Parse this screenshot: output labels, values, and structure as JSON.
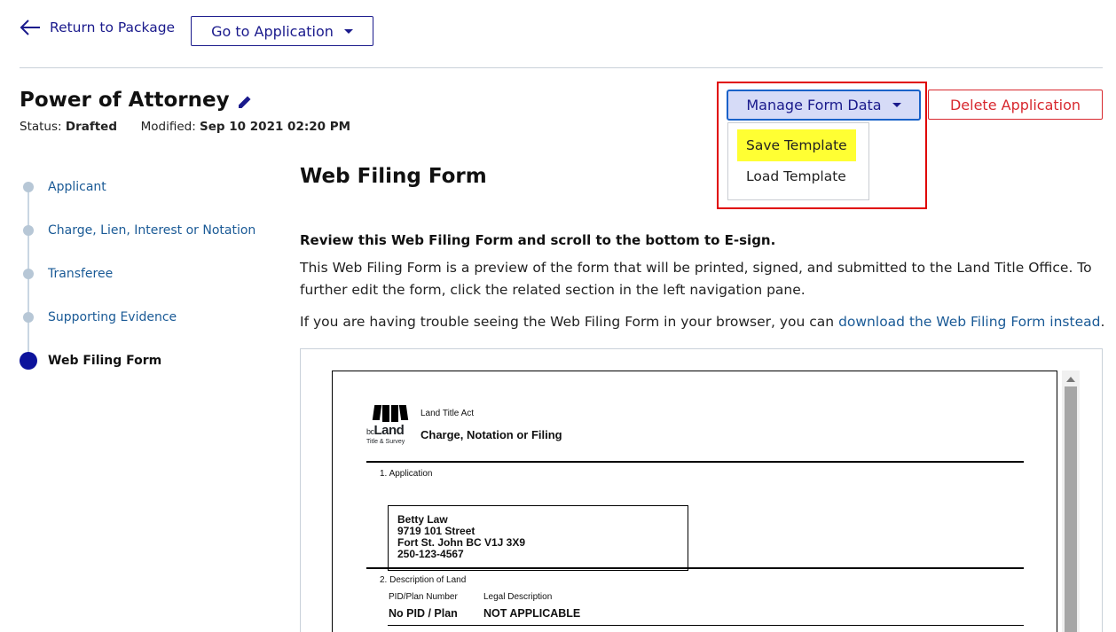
{
  "topbar": {
    "back_label": "Return to Package",
    "go_label": "Go to Application"
  },
  "header": {
    "title": "Power of Attorney",
    "status_label": "Status:",
    "status_value": "Drafted",
    "modified_label": "Modified:",
    "modified_value": "Sep 10 2021 02:20 PM"
  },
  "actions": {
    "manage_label": "Manage Form Data",
    "menu_items": [
      "Save Template",
      "Load Template"
    ],
    "delete_label": "Delete Application"
  },
  "steps": [
    {
      "label": "Applicant"
    },
    {
      "label": "Charge, Lien, Interest or Notation"
    },
    {
      "label": "Transferee"
    },
    {
      "label": "Supporting Evidence"
    },
    {
      "label": "Web Filing Form",
      "active": true
    }
  ],
  "main": {
    "heading": "Web Filing Form",
    "review": "Review this Web Filing Form and scroll to the bottom to E-sign.",
    "paragraph": "This Web Filing Form is a preview of the form that will be printed, signed, and submitted to the Land Title Office. To further edit the form, click the related section in the left navigation pane.",
    "trouble_prefix": "If you are having trouble seeing the Web Filing Form in your browser, you can ",
    "trouble_link": "download the Web Filing Form instead",
    "trouble_suffix": "."
  },
  "doc": {
    "logo_bc": "bc",
    "logo_land": "Land",
    "logo_sub": "Title & Survey",
    "act": "Land Title Act",
    "form_name": "Charge, Notation or Filing",
    "section1": "1. Application",
    "address": [
      "Betty Law",
      "9719 101 Street",
      "Fort St. John BC V1J 3X9",
      "250-123-4567"
    ],
    "section2": "2. Description of Land",
    "col_pid": "PID/Plan Number",
    "col_legal": "Legal Description",
    "pid_value": "No PID / Plan",
    "legal_value": "NOT APPLICABLE"
  },
  "colors": {
    "primary": "#1a1a8c",
    "danger": "#d8292f",
    "highlight": "#ffff33",
    "annotation": "#e00000"
  }
}
